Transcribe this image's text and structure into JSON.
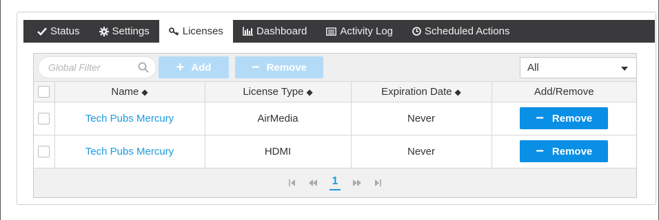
{
  "tabs": [
    {
      "label": "Status",
      "icon": "check-icon"
    },
    {
      "label": "Settings",
      "icon": "gear-icon"
    },
    {
      "label": "Licenses",
      "icon": "key-icon",
      "active": true
    },
    {
      "label": "Dashboard",
      "icon": "bar-chart-icon"
    },
    {
      "label": "Activity Log",
      "icon": "list-icon"
    },
    {
      "label": "Scheduled Actions",
      "icon": "clock-icon"
    }
  ],
  "toolbar": {
    "search_placeholder": "Global Filter",
    "add_label": "Add",
    "remove_label": "Remove",
    "filter_value": "All"
  },
  "table": {
    "columns": [
      "Name",
      "License Type",
      "Expiration Date",
      "Add/Remove"
    ],
    "rows": [
      {
        "name": "Tech Pubs Mercury",
        "license_type": "AirMedia",
        "expiration": "Never",
        "action": "Remove"
      },
      {
        "name": "Tech Pubs Mercury",
        "license_type": "HDMI",
        "expiration": "Never",
        "action": "Remove"
      }
    ]
  },
  "pagination": {
    "current_page": "1"
  },
  "colors": {
    "accent": "#0a8fe6",
    "tabbar": "#3a3a3c",
    "link": "#1a9be0",
    "disabled": "#b3dbf7"
  }
}
